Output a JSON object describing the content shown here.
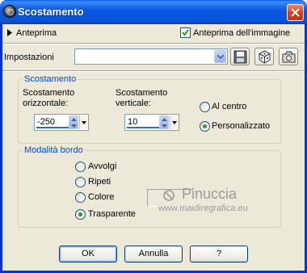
{
  "window": {
    "title": "Scostamento"
  },
  "preview": {
    "expander_label": "Anteprima",
    "image_preview_label": "Anteprima dell'immagine",
    "image_preview_checked": true
  },
  "settings": {
    "label": "Impostazioni",
    "preset_value": ""
  },
  "offset_group": {
    "title": "Scostamento",
    "horizontal_label_1": "Scostamento",
    "horizontal_label_2": "orizzontale:",
    "horizontal_value": "-250",
    "vertical_label_1": "Scostamento",
    "vertical_label_2": "verticale:",
    "vertical_value": "10",
    "center_label": "Al centro",
    "custom_label": "Personalizzato",
    "selected": "custom"
  },
  "edge_group": {
    "title": "Modalità bordo",
    "options": [
      "Avvolgi",
      "Ripeti",
      "Colore",
      "Trasparente"
    ],
    "selected": "Trasparente"
  },
  "watermark": {
    "name": "Pinuccia",
    "url": "www.maidiregrafica.eu"
  },
  "buttons": {
    "ok": "OK",
    "cancel": "Annulla",
    "help": "?"
  },
  "colors": {
    "title_bar": "#0a5fe8",
    "dialog_bg": "#ece9d8",
    "group_title": "#0046d5",
    "close_button": "#d6421c"
  },
  "icons": {
    "save_preset": "floppy-disk-icon",
    "randomize": "dice-icon",
    "reset": "camera-reset-icon"
  }
}
